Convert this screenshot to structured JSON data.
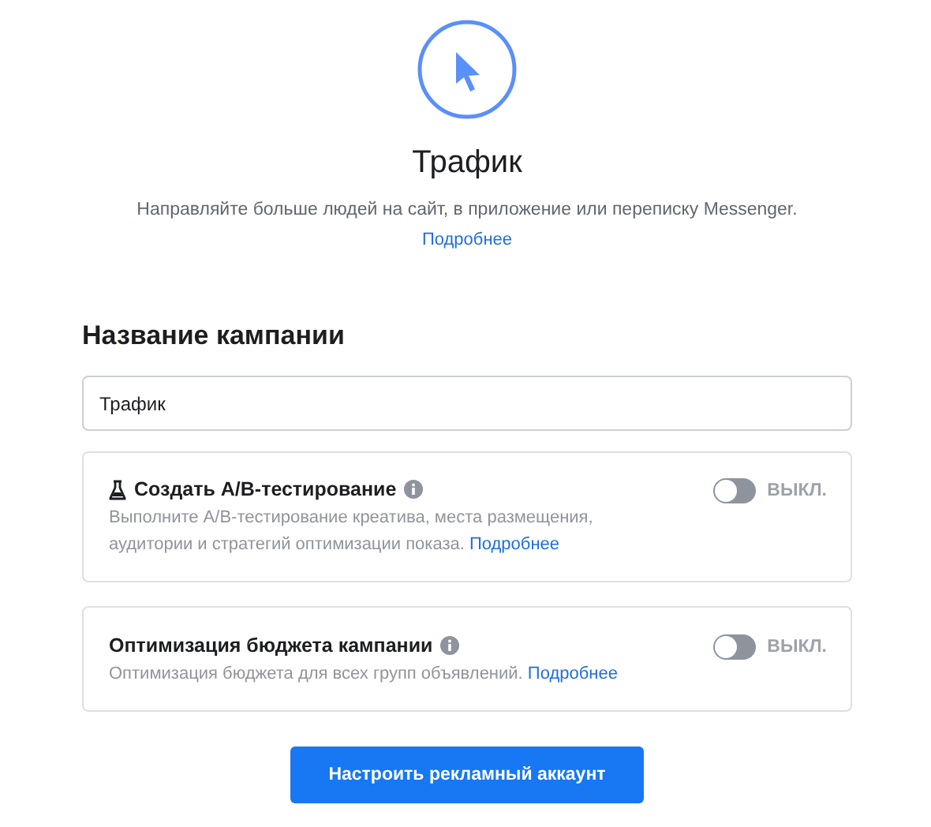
{
  "header": {
    "title": "Трафик",
    "description": "Направляйте больше людей на сайт, в приложение или переписку Messenger.",
    "description_link": "Подробнее"
  },
  "campaign_name": {
    "label": "Название кампании",
    "value": "Трафик"
  },
  "options": [
    {
      "kind": "experiment",
      "title": "Создать A/B-тестирование",
      "description": "Выполните A/B-тестирование креатива, места размещения, аудитории и стратегий оптимизации показа.",
      "link": "Подробнее",
      "on": false,
      "state_label": "ВЫКЛ."
    },
    {
      "kind": "plain",
      "title": "Оптимизация бюджета кампании",
      "description": "Оптимизация бюджета для всех групп объявлений.",
      "link": "Подробнее",
      "on": false,
      "state_label": "ВЫКЛ."
    }
  ],
  "button": "Настроить рекламный аккаунт"
}
